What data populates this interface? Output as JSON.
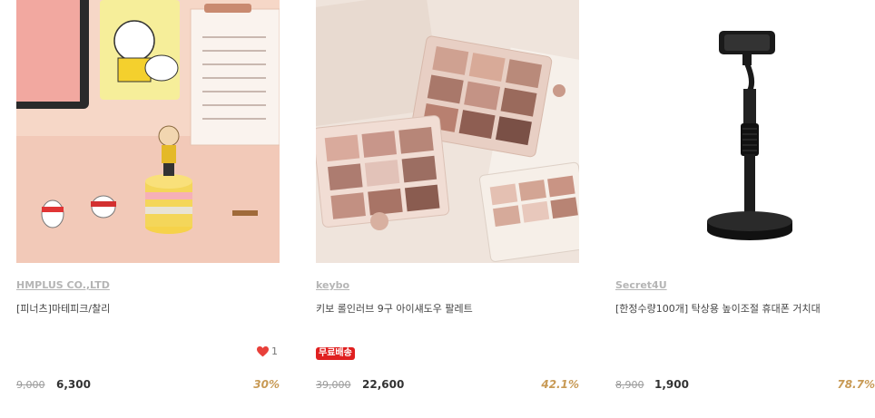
{
  "products": [
    {
      "brand": "HMPLUS CO.,LTD",
      "title": "[피너츠]마테피크/찰리",
      "likes": "1",
      "original_price": "9,000",
      "sale_price": "6,300",
      "discount": "30%"
    },
    {
      "brand": "keybo",
      "title": "키보 롤인러브 9구 아이섀도우 팔레트",
      "badge": "무료배송",
      "original_price": "39,000",
      "sale_price": "22,600",
      "discount": "42.1%"
    },
    {
      "brand": "Secret4U",
      "title": "[한정수량100개] 탁상용 높이조절 휴대폰 거치대",
      "original_price": "8,900",
      "sale_price": "1,900",
      "discount": "78.7%"
    }
  ],
  "colors": {
    "brand_link": "#b5b5b5",
    "discount": "#c89a55",
    "badge_bg": "#e02020",
    "heart": "#e8403a"
  },
  "icons": [
    "heart-icon"
  ]
}
